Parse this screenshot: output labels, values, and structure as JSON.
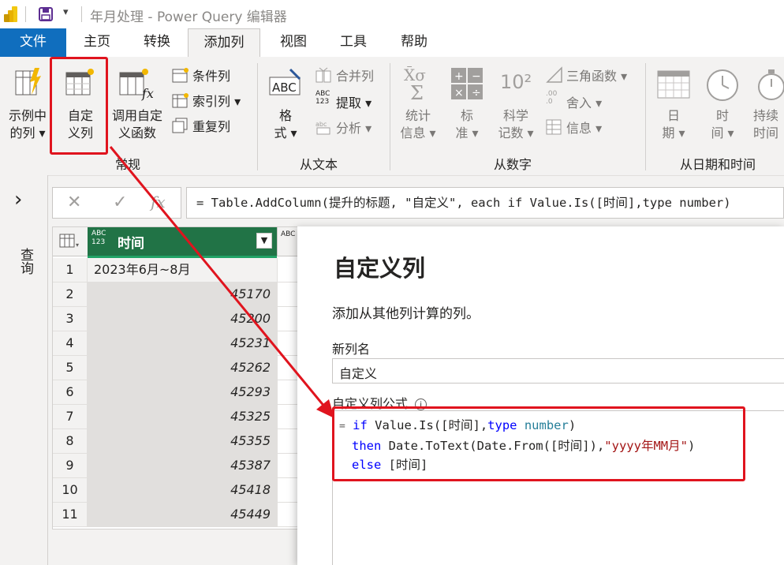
{
  "window": {
    "title": "年月处理 - Power Query 编辑器"
  },
  "tabs": [
    {
      "label": "文件"
    },
    {
      "label": "主页"
    },
    {
      "label": "转换"
    },
    {
      "label": "添加列"
    },
    {
      "label": "视图"
    },
    {
      "label": "工具"
    },
    {
      "label": "帮助"
    }
  ],
  "ribbon": {
    "general": {
      "example_col": [
        "示例中",
        "的列 ▾"
      ],
      "custom_col": [
        "自定",
        "义列"
      ],
      "invoke_fn": [
        "调用自定",
        "义函数"
      ],
      "conditional": "条件列",
      "index": "索引列 ▾",
      "duplicate": "重复列",
      "group_label": "常规"
    },
    "text": {
      "format": [
        "格",
        "式 ▾"
      ],
      "merge": "合并列",
      "extract": "提取 ▾",
      "parse": "分析 ▾",
      "extract_icon_text": "ABC 123",
      "group_label": "从文本"
    },
    "number": {
      "stats": [
        "统计",
        "信息 ▾"
      ],
      "standard": [
        "标",
        "准 ▾"
      ],
      "scientific": [
        "科学",
        "记数 ▾"
      ],
      "trig": "三角函数 ▾",
      "round": "舍入 ▾",
      "info": "信息 ▾",
      "sci_icon": "10²",
      "round_icon": ".00 .0",
      "group_label": "从数字"
    },
    "datetime": {
      "date": [
        "日",
        "期 ▾"
      ],
      "time": [
        "时",
        "间 ▾"
      ],
      "duration": [
        "持续",
        "时间"
      ],
      "group_label": "从日期和时间"
    }
  },
  "query_pane": {
    "label": "查询",
    "expand_glyph": "›"
  },
  "formula_bar": {
    "cancel": "✕",
    "commit": "✓",
    "fx": "fx",
    "formula": "= Table.AddColumn(提升的标题, \"自定义\", each if Value.Is([时间],type number)"
  },
  "grid": {
    "column_header": "时间",
    "type_icon": "ABC 123",
    "next_col_type": "ABC",
    "rows": [
      {
        "n": "1",
        "v": "2023年6月~8月"
      },
      {
        "n": "2",
        "v": "45170"
      },
      {
        "n": "3",
        "v": "45200"
      },
      {
        "n": "4",
        "v": "45231"
      },
      {
        "n": "5",
        "v": "45262"
      },
      {
        "n": "6",
        "v": "45293"
      },
      {
        "n": "7",
        "v": "45325"
      },
      {
        "n": "8",
        "v": "45355"
      },
      {
        "n": "9",
        "v": "45387"
      },
      {
        "n": "10",
        "v": "45418"
      },
      {
        "n": "11",
        "v": "45449"
      }
    ]
  },
  "dialog": {
    "title": "自定义列",
    "subtitle": "添加从其他列计算的列。",
    "name_label": "新列名",
    "name_value": "自定义",
    "formula_label": "自定义列公式",
    "info_glyph": "i",
    "formula_lines": {
      "l1_eq": "=",
      "l1_kw": "if",
      "l1_a": " Value.Is([时间],",
      "l1_type": "type",
      "l1_num": "number",
      "l1_b": ")",
      "l2_kw": "then",
      "l2_a": " Date.ToText(Date.From([时间]),",
      "l2_str": "\"yyyy年MM月\"",
      "l2_b": ")",
      "l3_kw": "else",
      "l3_a": " [时间]"
    }
  },
  "colors": {
    "accent": "#106ebe",
    "header_green": "#217346",
    "highlight_red": "#e0141e"
  }
}
